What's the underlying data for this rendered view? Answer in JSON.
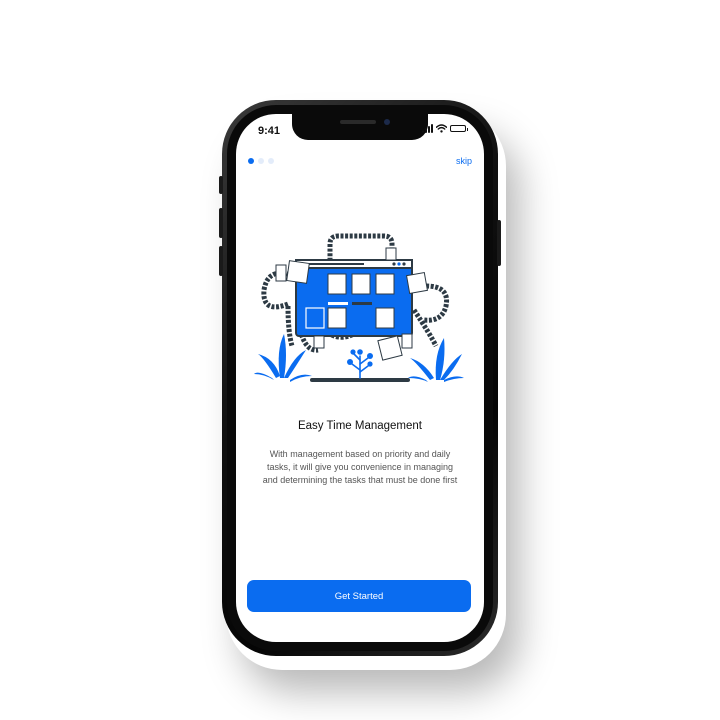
{
  "status_bar": {
    "time": "9:41",
    "icons": [
      "signal-icon",
      "wifi-icon",
      "battery-icon"
    ]
  },
  "onboarding": {
    "pager": {
      "total": 3,
      "active_index": 0
    },
    "skip_label": "skip",
    "title": "Easy Time Management",
    "description": "With management based on priority and daily tasks, it will give you convenience in managing and determining the tasks that must be done first",
    "cta_label": "Get Started"
  },
  "colors": {
    "accent": "#0a6cf0",
    "dot_inactive": "#e3ecfa",
    "title": "#111111",
    "text_secondary": "#555555",
    "illustration_dark": "#2d3a44"
  }
}
